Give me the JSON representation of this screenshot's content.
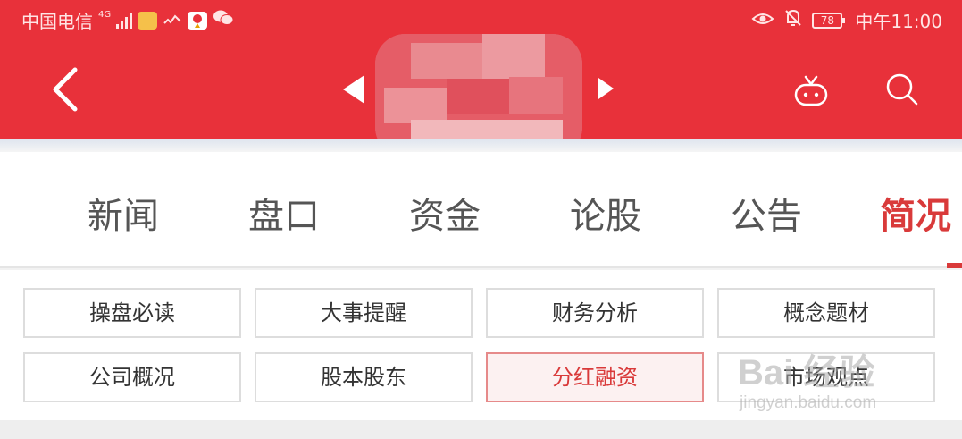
{
  "status_bar": {
    "carrier": "中国电信",
    "network": "4G",
    "battery": "78",
    "time": "中午11:00",
    "icons": [
      "signal-icon",
      "app-notification-icon",
      "wifi-icon",
      "map-app-icon",
      "wechat-icon",
      "eye-icon",
      "mute-bell-icon",
      "battery-icon"
    ]
  },
  "title_bar": {
    "icons": [
      "back-arrow-icon",
      "prev-triangle-icon",
      "next-triangle-icon",
      "robot-assistant-icon",
      "search-icon"
    ]
  },
  "tabs": [
    {
      "label": "新闻",
      "active": false
    },
    {
      "label": "盘口",
      "active": false
    },
    {
      "label": "资金",
      "active": false
    },
    {
      "label": "论股",
      "active": false
    },
    {
      "label": "公告",
      "active": false
    },
    {
      "label": "简况",
      "active": true
    }
  ],
  "buttons": [
    {
      "label": "操盘必读",
      "active": false
    },
    {
      "label": "大事提醒",
      "active": false
    },
    {
      "label": "财务分析",
      "active": false
    },
    {
      "label": "概念题材",
      "active": false
    },
    {
      "label": "公司概况",
      "active": false
    },
    {
      "label": "股本股东",
      "active": false
    },
    {
      "label": "分红融资",
      "active": true
    },
    {
      "label": "市场观点",
      "active": false
    }
  ],
  "watermark": {
    "main": "Bai 经验",
    "sub": "jingyan.baidu.com"
  },
  "colors": {
    "brand_red": "#e8313a",
    "active_text": "#d93a3a",
    "tab_text": "#555555",
    "button_border": "#dddddd"
  }
}
